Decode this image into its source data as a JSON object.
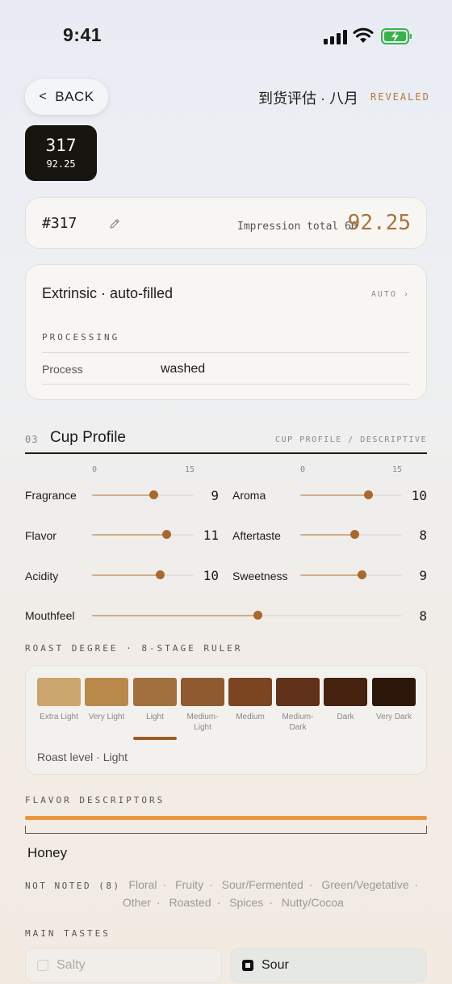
{
  "status_bar": {
    "time": "9:41"
  },
  "header": {
    "back_label": "BACK",
    "title": "到货评估 · 八月",
    "revealed": "REVEALED"
  },
  "badge": {
    "number": "317",
    "score": "92.25"
  },
  "summary": {
    "id": "#317",
    "impression_label": "Impression total 60",
    "total": "92.25"
  },
  "extrinsic": {
    "title": "Extrinsic · auto-filled",
    "auto_label": "AUTO ›",
    "section": "PROCESSING",
    "process_label": "Process",
    "process_value": "washed"
  },
  "cup_profile": {
    "number": "03",
    "title": "Cup Profile",
    "subtitle": "CUP PROFILE / DESCRIPTIVE",
    "scale_min": "0",
    "scale_max": "15",
    "max": 15,
    "attributes": [
      {
        "name": "Fragrance",
        "value": "9",
        "level": 9
      },
      {
        "name": "Aroma",
        "value": "10",
        "level": 10
      },
      {
        "name": "Flavor",
        "value": "11",
        "level": 11
      },
      {
        "name": "Aftertaste",
        "value": "8",
        "level": 8
      },
      {
        "name": "Acidity",
        "value": "10",
        "level": 10
      },
      {
        "name": "Sweetness",
        "value": "9",
        "level": 9
      },
      {
        "name": "Mouthfeel",
        "value": "8",
        "level": 8
      }
    ]
  },
  "roast": {
    "heading": "ROAST DEGREE · 8-STAGE RULER",
    "stages": [
      {
        "label": "Extra Light",
        "color": "#caa56d"
      },
      {
        "label": "Very Light",
        "color": "#b9894c"
      },
      {
        "label": "Light",
        "color": "#a2703e"
      },
      {
        "label": "Medium-Light",
        "color": "#8f5a2f"
      },
      {
        "label": "Medium",
        "color": "#7a4520"
      },
      {
        "label": "Medium-Dark",
        "color": "#603219"
      },
      {
        "label": "Dark",
        "color": "#452310"
      },
      {
        "label": "Very Dark",
        "color": "#2d170b"
      }
    ],
    "selected_index": 2,
    "level_text": "Roast level · Light"
  },
  "flavor": {
    "heading": "FLAVOR DESCRIPTORS",
    "selected": "Honey",
    "not_noted_label": "NOT NOTED (8)",
    "not_noted": [
      "Floral",
      "Fruity",
      "Sour/Fermented",
      "Green/Vegetative",
      "Other",
      "Roasted",
      "Spices",
      "Nutty/Cocoa"
    ]
  },
  "main_tastes": {
    "heading": "MAIN TASTES",
    "items": [
      {
        "label": "Salty",
        "checked": false
      },
      {
        "label": "Sour",
        "checked": true
      }
    ]
  },
  "colors": {
    "accent": "#a8753a",
    "knob": "#a8692f",
    "flavor_bar": "#e9983f"
  }
}
